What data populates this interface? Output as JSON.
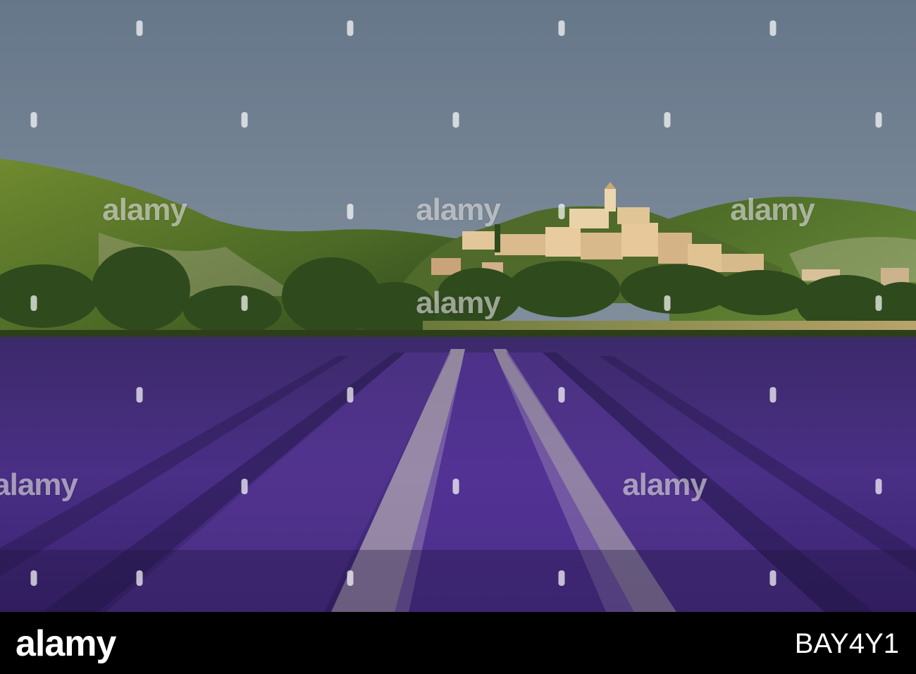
{
  "watermark": {
    "text": "alamy"
  },
  "footer": {
    "brand": "alamy",
    "image_code": "BAY4Y1"
  },
  "colors": {
    "sky_top": "#69798b",
    "sky_bottom": "#8e9aa8",
    "hill": "#5a7a2c",
    "lavender": "#4b2f86",
    "strip": "#000000"
  }
}
